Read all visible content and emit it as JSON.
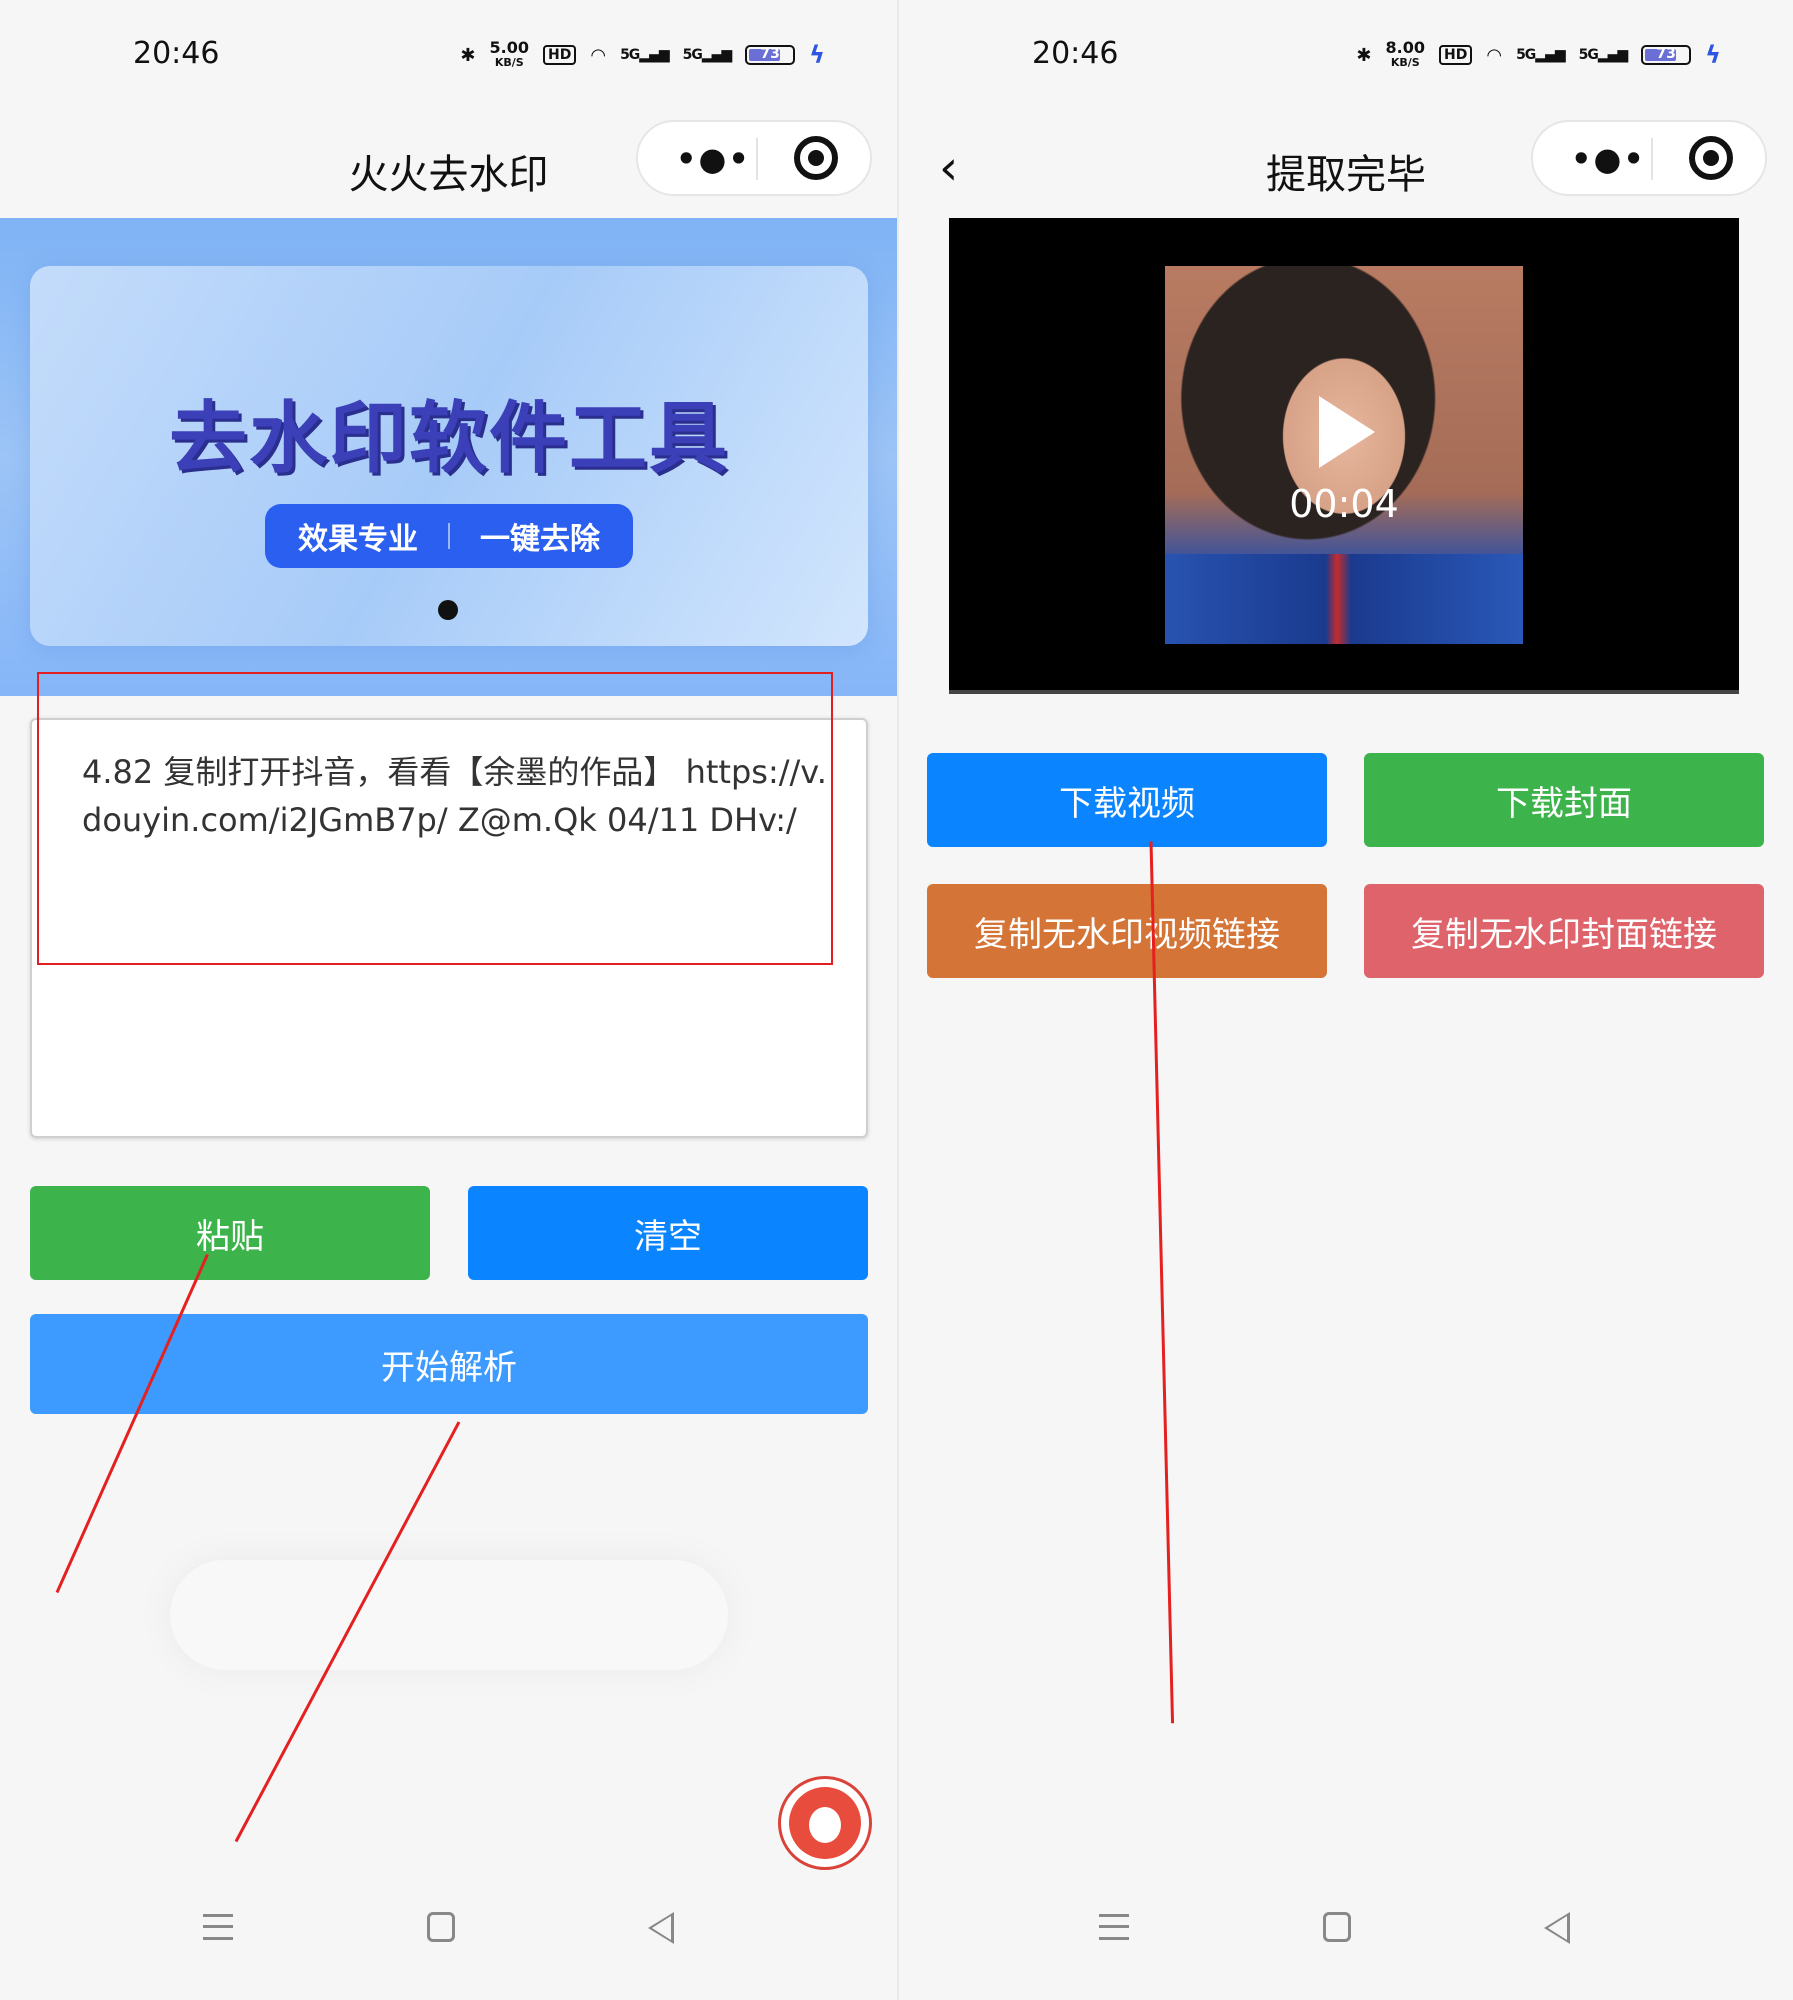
{
  "status": {
    "time": "20:46",
    "left_speed_value": "5.00",
    "right_speed_value": "8.00",
    "speed_unit": "KB/S",
    "hd": "HD",
    "net": "5G",
    "battery": "73",
    "colors": {
      "battery_fill": "#6a6fd6",
      "bolt": "#2e55e0"
    }
  },
  "left": {
    "title": "火火去水印",
    "banner": {
      "title": "去水印软件工具",
      "tag1": "效果专业",
      "tag2": "一键去除"
    },
    "input_text": "4.82 复制打开抖音，看看【余墨的作品】 https://v.douyin.com/i2JGmB7p/ Z@m.Qk 04/11 DHv:/",
    "paste_label": "粘贴",
    "clear_label": "清空",
    "parse_label": "开始解析",
    "colors": {
      "paste": "#3db44b",
      "clear": "#0a84ff",
      "parse": "#3d9bff",
      "annotation": "#e42020"
    }
  },
  "right": {
    "title": "提取完毕",
    "video_time": "00:04",
    "download_video": "下载视频",
    "download_cover": "下载封面",
    "copy_video_link": "复制无水印视频链接",
    "copy_cover_link": "复制无水印封面链接",
    "colors": {
      "download_video": "#0a84ff",
      "download_cover": "#3db44b",
      "copy_video_link": "#d47436",
      "copy_cover_link": "#de636a"
    }
  }
}
